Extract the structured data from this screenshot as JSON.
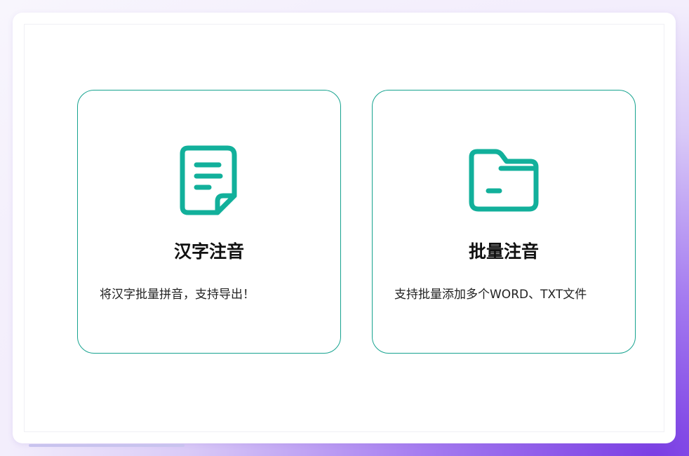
{
  "cards": [
    {
      "title": "汉字注音",
      "description": "将汉字批量拼音，支持导出！",
      "icon": "document-icon"
    },
    {
      "title": "批量注音",
      "description": "支持批量添加多个WORD、TXT文件",
      "icon": "folder-icon"
    }
  ],
  "colors": {
    "accent": "#16a38f",
    "icon": "#12b09b"
  }
}
